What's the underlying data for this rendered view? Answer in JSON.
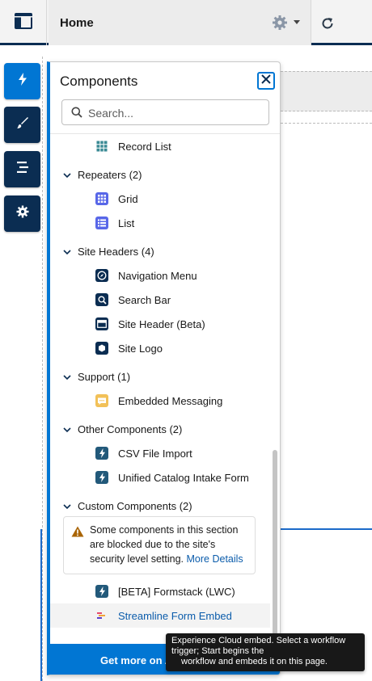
{
  "topbar": {
    "app_icon": "layout-panel-icon",
    "page_title": "Home",
    "settings_icon": "gear-icon",
    "refresh_icon": "refresh-icon"
  },
  "rail": [
    {
      "icon": "lightning-icon",
      "active": true
    },
    {
      "icon": "brush-icon",
      "active": false
    },
    {
      "icon": "page-structure-icon",
      "active": false
    },
    {
      "icon": "gear-icon",
      "active": false
    }
  ],
  "panel": {
    "title": "Components",
    "close_icon": "close-icon",
    "search_placeholder": "Search...",
    "first_item": {
      "label": "Record List",
      "icon": "table-icon"
    },
    "sections": [
      {
        "label": "Repeaters (2)",
        "items": [
          {
            "label": "Grid",
            "icon": "grid-icon"
          },
          {
            "label": "List",
            "icon": "list-icon"
          }
        ]
      },
      {
        "label": "Site Headers (4)",
        "items": [
          {
            "label": "Navigation Menu",
            "icon": "compass-icon"
          },
          {
            "label": "Search Bar",
            "icon": "search-icon"
          },
          {
            "label": "Site Header (Beta)",
            "icon": "header-icon"
          },
          {
            "label": "Site Logo",
            "icon": "logo-icon"
          }
        ]
      },
      {
        "label": "Support (1)",
        "items": [
          {
            "label": "Embedded Messaging",
            "icon": "chat-icon"
          }
        ]
      },
      {
        "label": "Other Components (2)",
        "items": [
          {
            "label": "CSV File Import",
            "icon": "lightning-icon"
          },
          {
            "label": "Unified Catalog Intake Form",
            "icon": "lightning-icon"
          }
        ]
      },
      {
        "label": "Custom Components (2)",
        "items": [
          {
            "label": "[BETA] Formstack (LWC)",
            "icon": "lightning-icon"
          },
          {
            "label": "Streamline Form Embed",
            "icon": "streamline-logo-icon"
          }
        ]
      }
    ],
    "warning": {
      "text": "Some components in this section are blocked due to the site's security level setting.",
      "link": "More Details"
    },
    "footer": "Get more on AppExchange"
  },
  "tooltip": {
    "line1": "Experience Cloud embed. Select a workflow",
    "line2": "trigger; Start begins the",
    "line3": "workflow and embeds it on this page."
  },
  "colors": {
    "brand_blue": "#0176d3",
    "navy": "#0b2d52",
    "link": "#0b5cab",
    "tooltip_bg": "#181818"
  }
}
